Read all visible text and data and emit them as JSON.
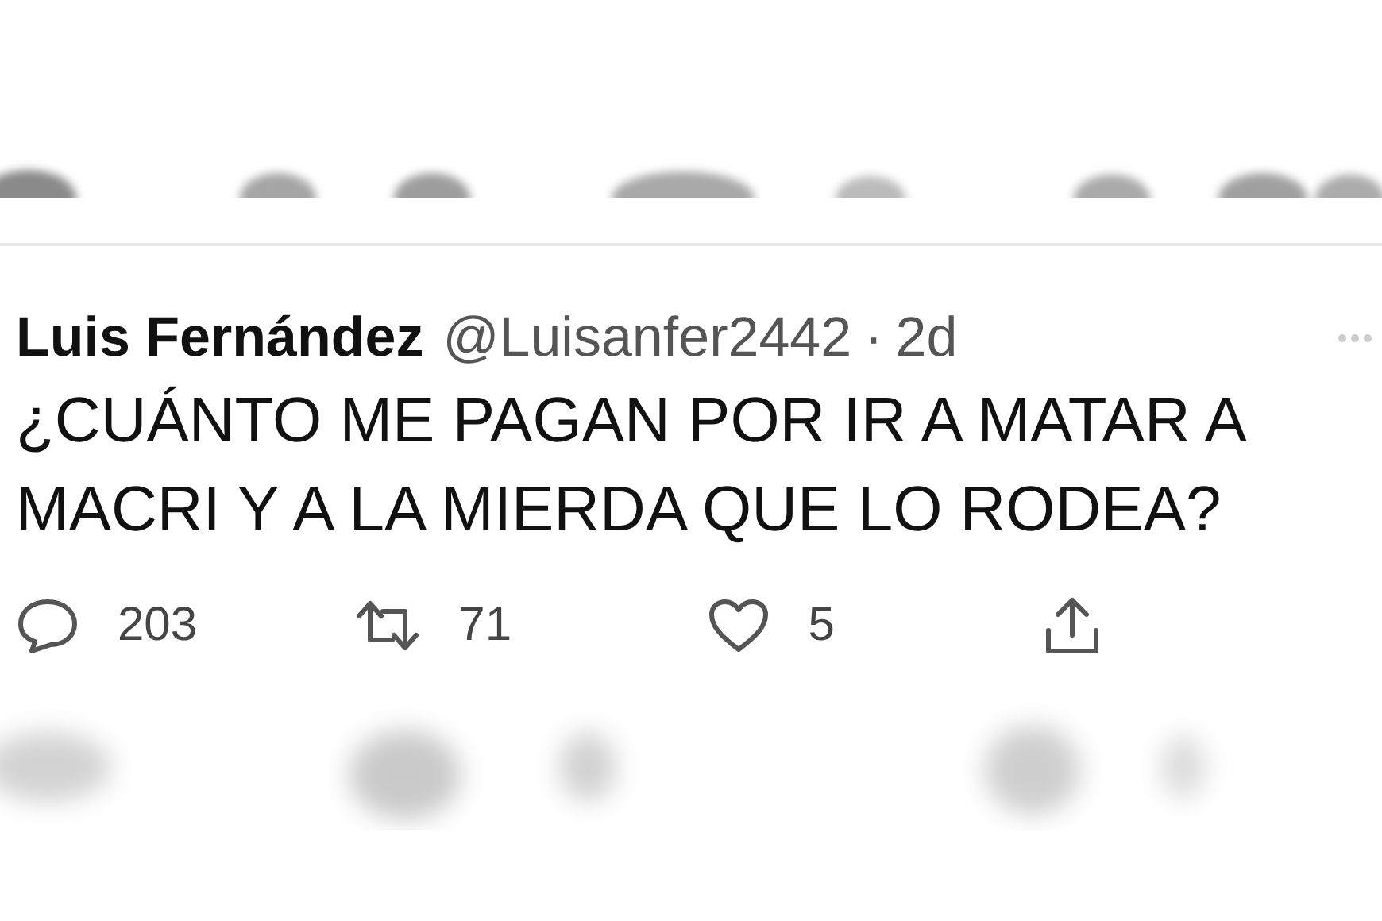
{
  "tweet": {
    "name": "Luis Fernández",
    "handle": "@Luisanfer2442",
    "separator": "·",
    "time": "2d",
    "text": "¿CUÁNTO ME PAGAN POR IR A MATAR A MACRI Y A LA MIERDA QUE LO RODEA?",
    "actions": [
      {
        "kind": "reply",
        "count": "203"
      },
      {
        "kind": "retweet",
        "count": "71"
      },
      {
        "kind": "like",
        "count": "5"
      },
      {
        "kind": "share"
      }
    ]
  }
}
